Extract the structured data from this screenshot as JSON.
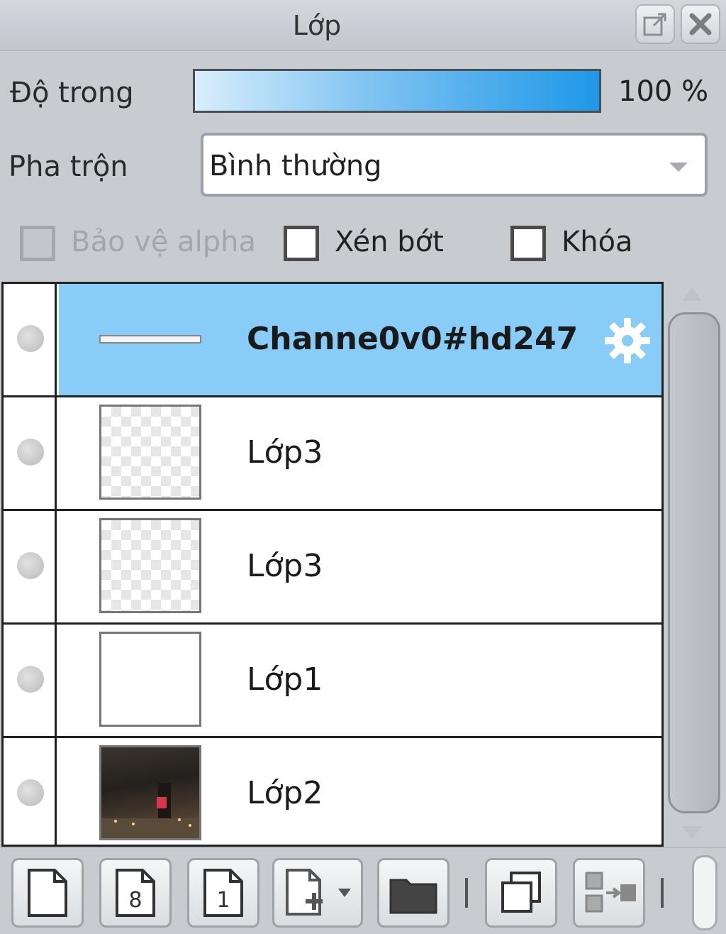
{
  "panel": {
    "title": "Lớp"
  },
  "opacity": {
    "label": "Độ trong",
    "value": "100 %",
    "level_percent": 100
  },
  "blend": {
    "label": "Pha trộn",
    "selected": "Bình thường"
  },
  "options": {
    "protect_alpha": "Bảo vệ alpha",
    "clipping": "Xén bớt",
    "lock": "Khóa"
  },
  "layers": [
    {
      "name": "Channe0v0#hd247",
      "selected": true,
      "thumb": "line"
    },
    {
      "name": "Lớp3",
      "selected": false,
      "thumb": "transparent"
    },
    {
      "name": "Lớp3",
      "selected": false,
      "thumb": "transparent"
    },
    {
      "name": "Lớp1",
      "selected": false,
      "thumb": "white"
    },
    {
      "name": "Lớp2",
      "selected": false,
      "thumb": "photo"
    }
  ],
  "toolbar": {
    "tools": [
      "new-layer-icon",
      "new-8bit-layer-icon",
      "new-1bit-layer-icon",
      "new-special-layer-icon",
      "new-folder-icon",
      "duplicate-layer-icon",
      "merge-down-icon"
    ]
  },
  "colors": {
    "selected_row": "#87cdf8",
    "opacity_fill": "#1e98e8"
  }
}
